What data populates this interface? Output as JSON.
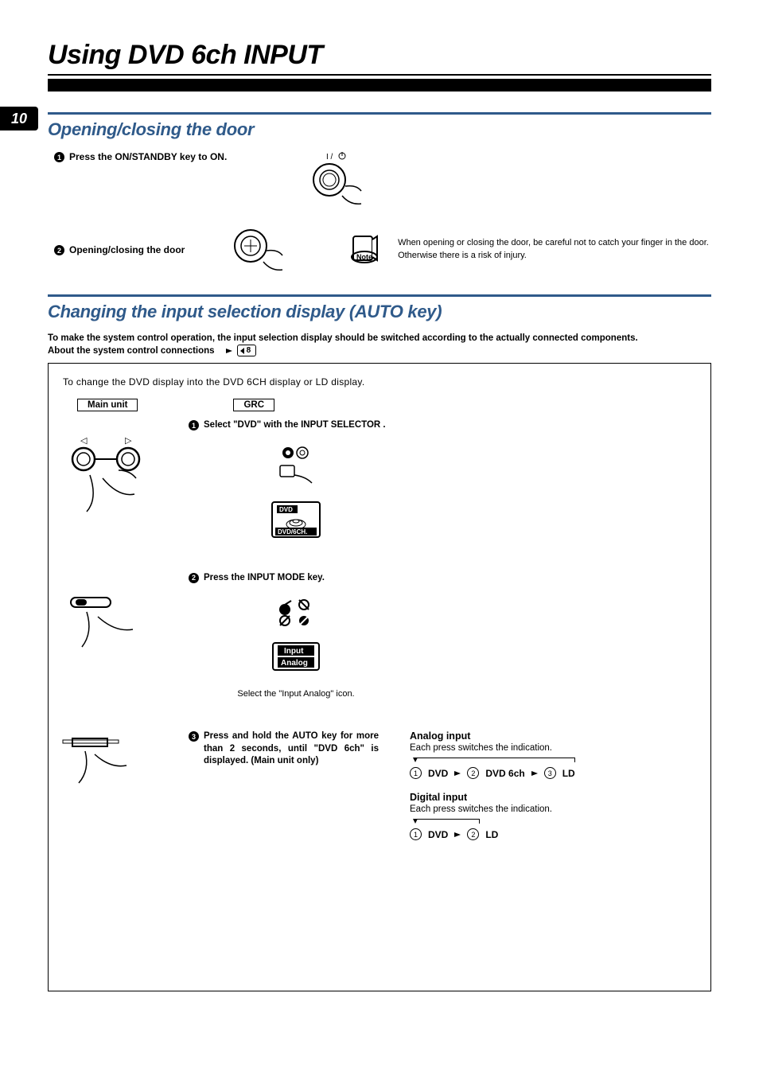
{
  "page_number": "10",
  "title": "Using DVD 6ch INPUT",
  "section1": {
    "heading": "Opening/closing the door",
    "steps": [
      {
        "bullet": "1",
        "text": "Press the ON/STANDBY key to ON.",
        "icon_label": "I / ⏻"
      },
      {
        "bullet": "2",
        "text": "Opening/closing the door"
      }
    ],
    "note": "When opening or closing the door, be careful not to catch your finger in the door. Otherwise there is a risk of injury."
  },
  "section2": {
    "heading": "Changing the input selection display (AUTO key)",
    "intro": "To make the system control operation, the input selection display should be switched according to the actually connected components.",
    "about": "About the system control connections",
    "page_ref": "8",
    "box": {
      "intro": "To change the DVD display into the DVD 6CH display or LD display.",
      "label_main": "Main unit",
      "label_grc": "GRC",
      "steps": [
        {
          "bullet": "1",
          "text": "Select \"DVD\" with the INPUT SELECTOR .",
          "display_top": "DVD",
          "display_bottom": "DVD/6CH."
        },
        {
          "bullet": "2",
          "text": "Press the INPUT MODE key.",
          "caption": "Select the \"Input Analog\" icon.",
          "display_top": "Input",
          "display_bottom": "Analog"
        },
        {
          "bullet": "3",
          "text": "Press and hold the AUTO key for more than 2 seconds, until \"DVD 6ch\" is displayed. (Main unit only)"
        }
      ],
      "right": {
        "analog": {
          "title": "Analog input",
          "desc": "Each press switches the indication.",
          "seq": [
            "DVD",
            "DVD 6ch",
            "LD"
          ]
        },
        "digital": {
          "title": "Digital input",
          "desc": "Each press switches the indication.",
          "seq": [
            "DVD",
            "LD"
          ]
        }
      },
      "selector_arrows": {
        "left": "◁",
        "right": "▷"
      }
    }
  }
}
